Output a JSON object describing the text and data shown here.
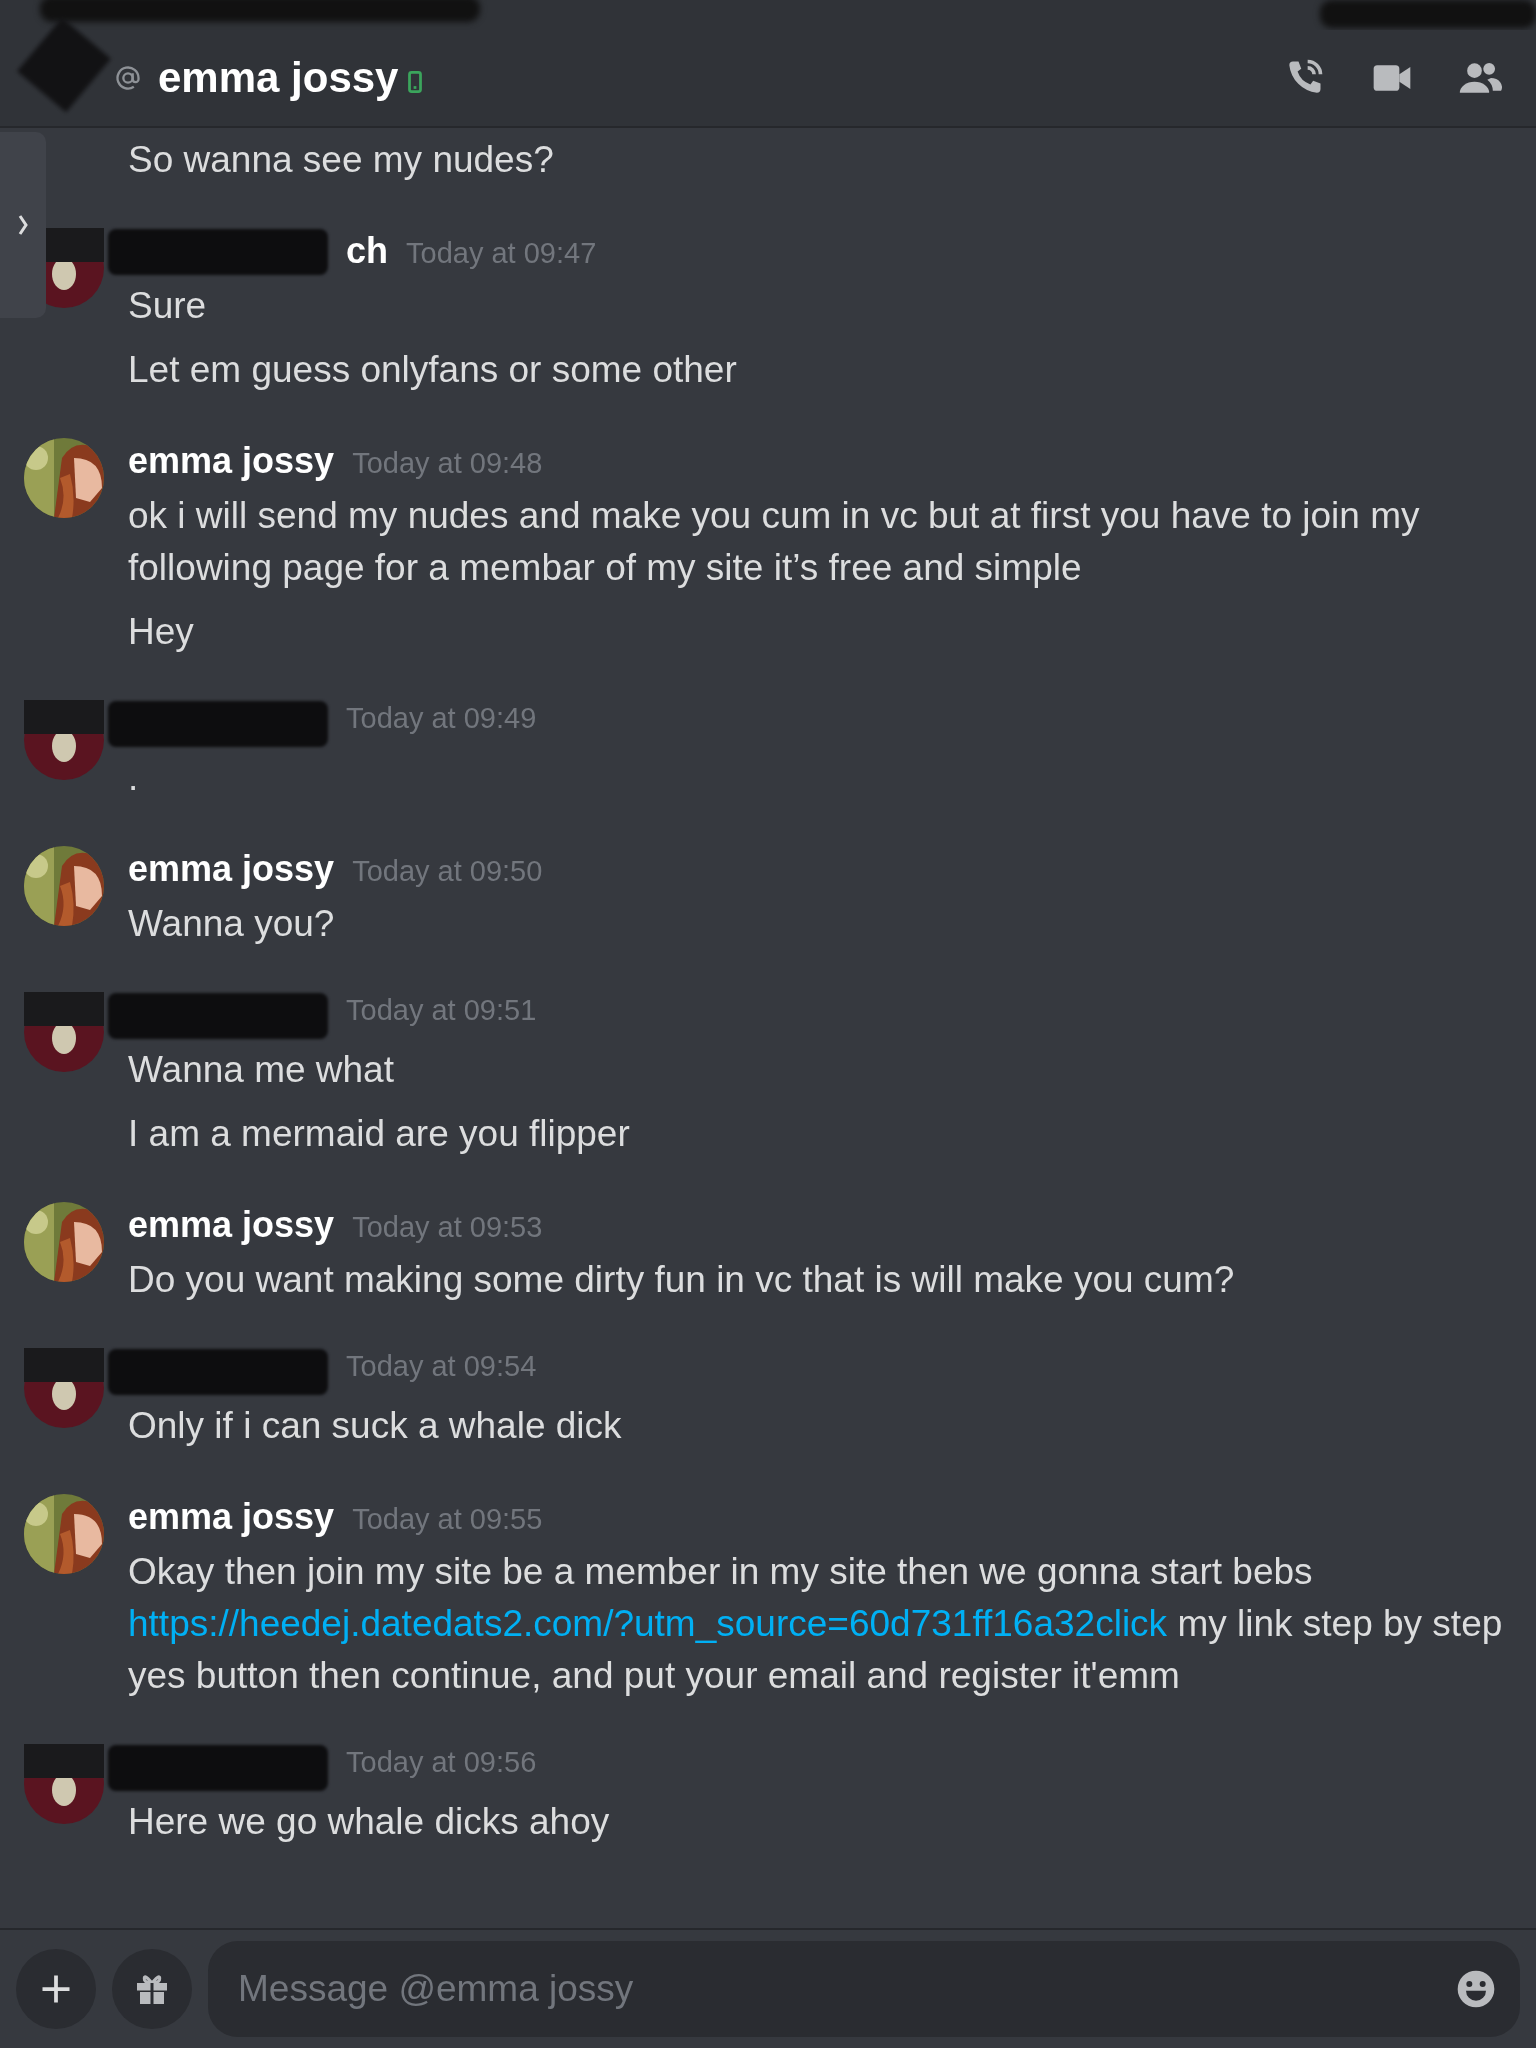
{
  "header": {
    "title": "emma jossy"
  },
  "messages": [
    {
      "kind": "continuation",
      "lines": [
        [
          {
            "text": "So wanna see my nudes?"
          }
        ]
      ]
    },
    {
      "kind": "redacted",
      "author_fragment": "ch",
      "time": "Today at 09:47",
      "lines": [
        [
          {
            "text": "Sure"
          }
        ],
        [
          {
            "text": "Let em guess onlyfans or some other"
          }
        ]
      ]
    },
    {
      "kind": "named",
      "author": "emma jossy",
      "time": "Today at 09:48",
      "lines": [
        [
          {
            "text": "ok i will send my nudes and make you cum in vc but at first you have to join my following  page for a membar of my site it’s free and simple"
          }
        ],
        [
          {
            "text": "Hey"
          }
        ]
      ]
    },
    {
      "kind": "redacted",
      "time": "Today at 09:49",
      "lines": [
        [
          {
            "text": "."
          }
        ]
      ]
    },
    {
      "kind": "named",
      "author": "emma jossy",
      "time": "Today at 09:50",
      "lines": [
        [
          {
            "text": "Wanna you?"
          }
        ]
      ]
    },
    {
      "kind": "redacted",
      "time": "Today at 09:51",
      "lines": [
        [
          {
            "text": "Wanna me what"
          }
        ],
        [
          {
            "text": "I am a mermaid are you flipper"
          }
        ]
      ]
    },
    {
      "kind": "named",
      "author": "emma jossy",
      "time": "Today at 09:53",
      "lines": [
        [
          {
            "text": "Do you want making some dirty fun in vc that is will make you cum?"
          }
        ]
      ]
    },
    {
      "kind": "redacted",
      "time": "Today at 09:54",
      "lines": [
        [
          {
            "text": "Only if i can suck a whale dick"
          }
        ]
      ]
    },
    {
      "kind": "named",
      "author": "emma jossy",
      "time": "Today at 09:55",
      "lines": [
        [
          {
            "text": "Okay then join my site be a member in my site then we gonna start bebs "
          },
          {
            "link": "https://heedej.datedats2.com/?utm_source=60d731ff16a32click"
          },
          {
            "text": " my link step by step yes button then continue, and put your email and register it'emm"
          }
        ]
      ]
    },
    {
      "kind": "redacted",
      "time": "Today at 09:56",
      "lines": [
        [
          {
            "text": "Here we go  whale dicks ahoy"
          }
        ]
      ]
    }
  ],
  "composer": {
    "placeholder": "Message @emma jossy"
  }
}
